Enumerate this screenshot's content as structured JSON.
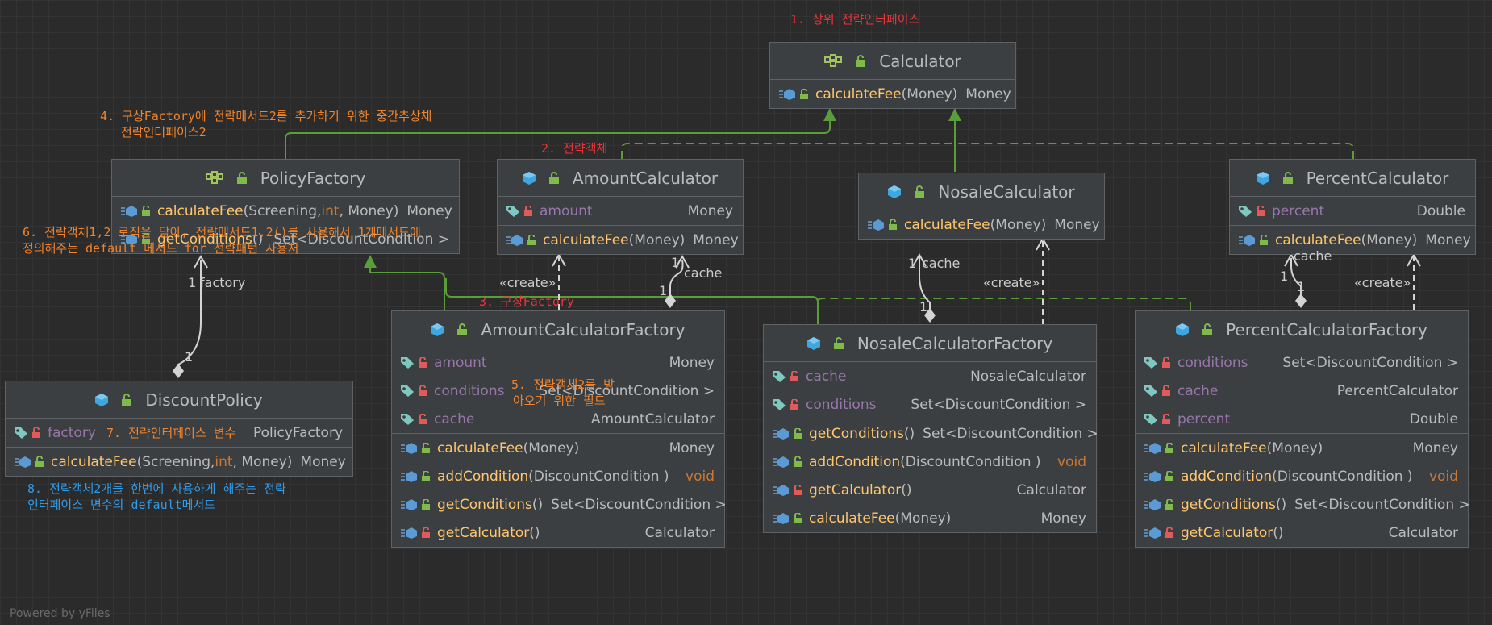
{
  "colors": {
    "background": "#2b2b2b",
    "node_fill": "#3c3f41",
    "realization_edge": "#5a9e3a",
    "association_edge": "#d4d4d4",
    "method_name": "#ffc66d",
    "field_name": "#9876aa",
    "keyword": "#cc7832",
    "note_red": "#e8353a",
    "note_orange": "#f0842c",
    "note_blue": "#2f9bea"
  },
  "nodes": {
    "calculator": {
      "title": "Calculator",
      "title_icon": "interface-icon",
      "methods": [
        {
          "name": "calculateFee",
          "params": "(Money)",
          "type": "Money"
        }
      ]
    },
    "policy_factory": {
      "title": "PolicyFactory",
      "title_icon": "interface-icon",
      "methods": [
        {
          "name": "calculateFee",
          "params": "(Screening, ",
          "kw": "int",
          "params2": ", Money)",
          "type": "Money"
        },
        {
          "name": "getConditions",
          "params": " ()",
          "type": "Set<DiscountCondition >"
        }
      ]
    },
    "amount_calculator": {
      "title": "AmountCalculator",
      "title_icon": "class-icon",
      "fields": [
        {
          "name": "amount",
          "type": "Money"
        }
      ],
      "methods": [
        {
          "name": "calculateFee",
          "params": "(Money)",
          "type": "Money"
        }
      ]
    },
    "nosale_calculator": {
      "title": "NosaleCalculator",
      "title_icon": "class-icon",
      "methods": [
        {
          "name": "calculateFee",
          "params": "(Money)",
          "type": "Money"
        }
      ]
    },
    "percent_calculator": {
      "title": "PercentCalculator",
      "title_icon": "class-icon",
      "fields": [
        {
          "name": "percent",
          "type": "Double"
        }
      ],
      "methods": [
        {
          "name": "calculateFee",
          "params": "(Money)",
          "type": "Money"
        }
      ]
    },
    "discount_policy": {
      "title": "DiscountPolicy",
      "title_icon": "class-icon",
      "fields": [
        {
          "name": "factory",
          "type": "PolicyFactory"
        }
      ],
      "methods": [
        {
          "name": "calculateFee",
          "params": "(Screening, ",
          "kw": "int",
          "params2": ", Money)",
          "type": "Money"
        }
      ]
    },
    "amount_calculator_factory": {
      "title": "AmountCalculatorFactory",
      "title_icon": "class-icon",
      "fields": [
        {
          "name": "amount",
          "type": "Money"
        },
        {
          "name": "conditions",
          "type": "Set<DiscountCondition >"
        },
        {
          "name": "cache",
          "type": "AmountCalculator"
        }
      ],
      "methods": [
        {
          "name": "calculateFee",
          "params": "(Money)",
          "type": "Money"
        },
        {
          "name": "addCondition",
          "params": " (DiscountCondition )",
          "type": "void"
        },
        {
          "name": "getConditions",
          "params": " ()",
          "type": "Set<DiscountCondition >"
        },
        {
          "name": "getCalculator",
          "params": " ()",
          "type": "Calculator"
        }
      ]
    },
    "nosale_calculator_factory": {
      "title": "NosaleCalculatorFactory",
      "title_icon": "class-icon",
      "fields": [
        {
          "name": "cache",
          "type": "NosaleCalculator"
        },
        {
          "name": "conditions",
          "type": "Set<DiscountCondition >"
        }
      ],
      "methods": [
        {
          "name": "getConditions",
          "params": " ()",
          "type": "Set<DiscountCondition >"
        },
        {
          "name": "addCondition",
          "params": " (DiscountCondition )",
          "type": "void"
        },
        {
          "name": "getCalculator",
          "params": " ()",
          "type": "Calculator"
        },
        {
          "name": "calculateFee",
          "params": "(Money)",
          "type": "Money"
        }
      ]
    },
    "percent_calculator_factory": {
      "title": "PercentCalculatorFactory",
      "title_icon": "class-icon",
      "fields": [
        {
          "name": "conditions",
          "type": "Set<DiscountCondition >"
        },
        {
          "name": "cache",
          "type": "PercentCalculator"
        },
        {
          "name": "percent",
          "type": "Double"
        }
      ],
      "methods": [
        {
          "name": "calculateFee",
          "params": "(Money)",
          "type": "Money"
        },
        {
          "name": "addCondition",
          "params": " (DiscountCondition )",
          "type": "void"
        },
        {
          "name": "getConditions",
          "params": " ()",
          "type": "Set<DiscountCondition >"
        },
        {
          "name": "getCalculator",
          "params": " ()",
          "type": "Calculator"
        }
      ]
    }
  },
  "edge_labels": {
    "factory_mult": "1",
    "factory_role": "factory",
    "factory_src_mult": "1",
    "amount_cache_mult": "1",
    "amount_cache_role": "cache",
    "amount_src_mult": "1",
    "amount_create": "«create»",
    "nosale_cache_mult": "1",
    "nosale_cache_role": "cache",
    "nosale_src_mult": "1",
    "nosale_create": "«create»",
    "percent_cache_mult": "1",
    "percent_cache_role": "cache",
    "percent_src_mult": "1",
    "percent_create": "«create»"
  },
  "notes": {
    "n1": "1. 상위 전략인터페이스",
    "n2": "2. 전략객체",
    "n3": "3. 구상Factory",
    "n4_line1": "4. 구상Factory에 전략메서드2를 추가하기 위한 중간추상체",
    "n4_line2": "전략인터페이스2",
    "n5_line1": "5. 전략객체2를 받",
    "n5_line2": "아오기 위한 필드",
    "n6_line1": "6. 전략객체1,2 로직을 담아, 전략메서드1,2()를 사용해서 1개메서드에",
    "n6_line2": "정의해주는 default 메서드 for 전략패턴 사용처",
    "n7": "7. 전략인터페이스 변수",
    "n8_line1": "8. 전략객체2개를 한번에 사용하게 해주는 전략",
    "n8_line2": "인터페이스 변수의 default메서드"
  },
  "footer": "Powered by yFiles"
}
